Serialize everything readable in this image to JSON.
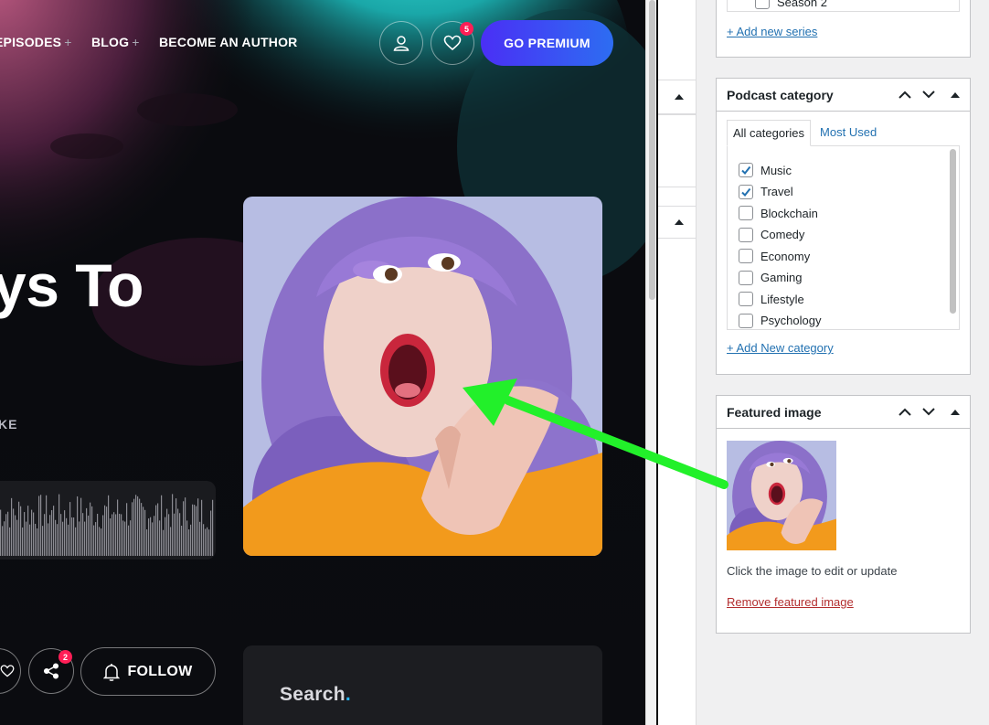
{
  "site": {
    "nav": {
      "episodes": "EPISODES",
      "blog": "BLOG",
      "become_author": "BECOME AN AUTHOR",
      "plus": "+"
    },
    "favorites_count": "5",
    "premium_label": "GO PREMIUM",
    "hero_title": "ys To",
    "author_fragment": "KE",
    "share_count": "2",
    "follow_label": "FOLLOW",
    "search_title": "Search",
    "search_dot": "."
  },
  "wp": {
    "series": {
      "last_item": "Season 2",
      "add_link": "+ Add new series"
    },
    "podcast_category": {
      "title": "Podcast category",
      "tab_all": "All categories",
      "tab_most_used": "Most Used",
      "items": [
        {
          "label": "Music",
          "checked": true
        },
        {
          "label": "Travel",
          "checked": true
        },
        {
          "label": "Blockchain",
          "checked": false
        },
        {
          "label": "Comedy",
          "checked": false
        },
        {
          "label": "Economy",
          "checked": false
        },
        {
          "label": "Gaming",
          "checked": false
        },
        {
          "label": "Lifestyle",
          "checked": false
        },
        {
          "label": "Psychology",
          "checked": false
        }
      ],
      "add_link": "+ Add New category"
    },
    "featured_image": {
      "title": "Featured image",
      "hint": "Click the image to edit or update",
      "remove_link": "Remove featured image"
    }
  },
  "colors": {
    "accent_green_arrow": "#22f02a",
    "wp_link": "#2271b1",
    "wp_danger": "#b32d2e",
    "premium_gradient_start": "#4a2ff5",
    "premium_gradient_end": "#2d6df2",
    "badge": "#ff1e56"
  }
}
